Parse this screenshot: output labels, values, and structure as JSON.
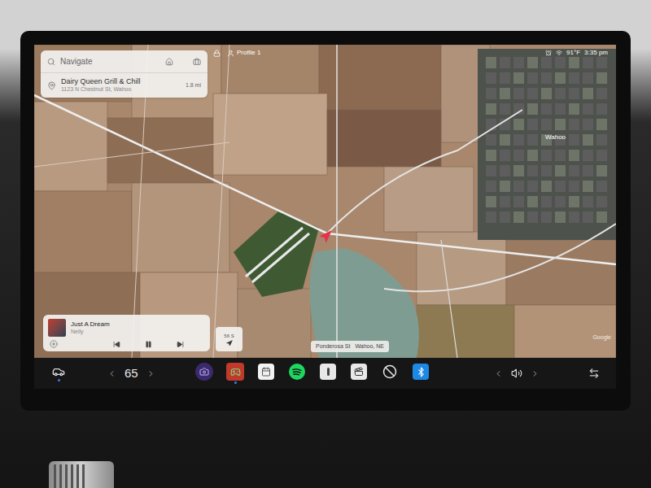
{
  "status_bar": {
    "profile": "Profile 1",
    "temperature": "91°F",
    "time": "3:35 pm"
  },
  "search": {
    "placeholder": "Navigate"
  },
  "destinations": [
    {
      "name": "Dairy Queen Grill & Chill",
      "address": "1123 N Chestnut St, Wahoo",
      "distance": "1.8 mi"
    }
  ],
  "map": {
    "labels": [
      {
        "text": "Wahoo"
      }
    ],
    "location": "Ponderosa St",
    "city": "Wahoo, NE",
    "compass": "56 S",
    "attribution": "Google"
  },
  "media": {
    "title": "Just A Dream",
    "artist": "Nelly",
    "playing": true
  },
  "taskbar": {
    "cabin_temperature": "65",
    "car_active": true,
    "apps": [
      {
        "kind": "camera",
        "active": false
      },
      {
        "kind": "arcade",
        "active": true
      },
      {
        "kind": "calendar",
        "active": false
      },
      {
        "kind": "spotify",
        "active": false
      },
      {
        "kind": "toybox",
        "active": false
      },
      {
        "kind": "theater",
        "active": false
      },
      {
        "kind": "dashcam",
        "active": false
      },
      {
        "kind": "bluetooth",
        "active": false
      }
    ]
  }
}
